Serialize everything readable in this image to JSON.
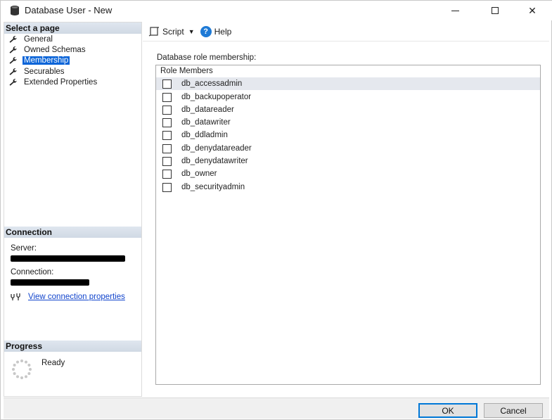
{
  "window": {
    "title": "Database User - New",
    "icon": "database-cylinder-icon",
    "controls": {
      "minimize_icon": "minimize-icon",
      "maximize_icon": "maximize-icon",
      "close_symbol": "✕"
    }
  },
  "left_panel": {
    "select_page_header": "Select a page",
    "pages": [
      {
        "label": "General",
        "icon": "wrench-icon",
        "selected": false
      },
      {
        "label": "Owned Schemas",
        "icon": "wrench-icon",
        "selected": false
      },
      {
        "label": "Membership",
        "icon": "wrench-icon",
        "selected": true
      },
      {
        "label": "Securables",
        "icon": "wrench-icon",
        "selected": false
      },
      {
        "label": "Extended Properties",
        "icon": "wrench-icon",
        "selected": false
      }
    ],
    "connection_header": "Connection",
    "server_label": "Server:",
    "connection_label": "Connection:",
    "view_connection_link": "View connection properties",
    "progress_header": "Progress",
    "progress_status": "Ready"
  },
  "toolbar": {
    "script_label": "Script",
    "help_label": "Help",
    "help_icon_glyph": "?"
  },
  "main": {
    "membership_label": "Database role membership:",
    "list_header": "Role Members",
    "roles": [
      {
        "name": "db_accessadmin",
        "checked": false,
        "selected": true
      },
      {
        "name": "db_backupoperator",
        "checked": false,
        "selected": false
      },
      {
        "name": "db_datareader",
        "checked": false,
        "selected": false
      },
      {
        "name": "db_datawriter",
        "checked": false,
        "selected": false
      },
      {
        "name": "db_ddladmin",
        "checked": false,
        "selected": false
      },
      {
        "name": "db_denydatareader",
        "checked": false,
        "selected": false
      },
      {
        "name": "db_denydatawriter",
        "checked": false,
        "selected": false
      },
      {
        "name": "db_owner",
        "checked": false,
        "selected": false
      },
      {
        "name": "db_securityadmin",
        "checked": false,
        "selected": false
      }
    ]
  },
  "footer": {
    "ok_label": "OK",
    "cancel_label": "Cancel"
  },
  "colors": {
    "selected_page_bg": "#0a64d8",
    "link_color": "#1144cc",
    "selected_row_bg": "#e5e8ee",
    "help_icon_bg": "#1e7ad6"
  }
}
